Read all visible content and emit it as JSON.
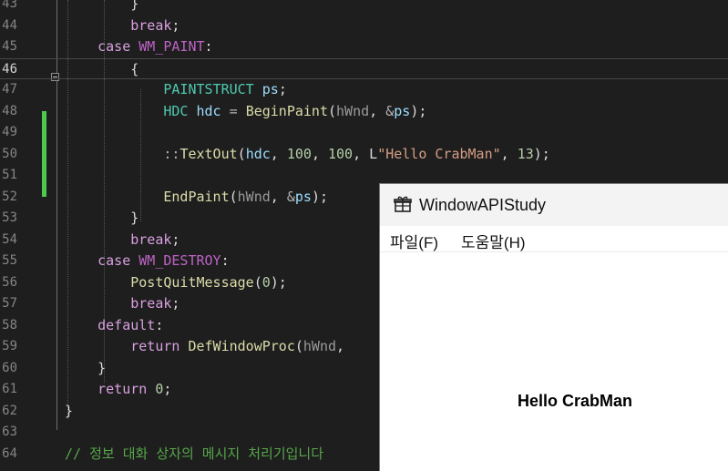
{
  "editor": {
    "lines": [
      {
        "num": "43",
        "tokens": [
          {
            "t": "        }",
            "c": ""
          }
        ]
      },
      {
        "num": "44",
        "tokens": [
          {
            "t": "        ",
            "c": ""
          },
          {
            "t": "break",
            "c": "t-ctl"
          },
          {
            "t": ";",
            "c": ""
          }
        ]
      },
      {
        "num": "45",
        "tokens": [
          {
            "t": "    ",
            "c": ""
          },
          {
            "t": "case",
            "c": "t-ctl"
          },
          {
            "t": " ",
            "c": ""
          },
          {
            "t": "WM_PAINT",
            "c": "t-mac"
          },
          {
            "t": ":",
            "c": ""
          }
        ]
      },
      {
        "num": "46",
        "tokens": [
          {
            "t": "        {",
            "c": ""
          }
        ]
      },
      {
        "num": "47",
        "tokens": [
          {
            "t": "            ",
            "c": ""
          },
          {
            "t": "PAINTSTRUCT",
            "c": "t-type"
          },
          {
            "t": " ",
            "c": ""
          },
          {
            "t": "ps",
            "c": "t-var"
          },
          {
            "t": ";",
            "c": ""
          }
        ]
      },
      {
        "num": "48",
        "tokens": [
          {
            "t": "            ",
            "c": ""
          },
          {
            "t": "HDC",
            "c": "t-type"
          },
          {
            "t": " ",
            "c": ""
          },
          {
            "t": "hdc",
            "c": "t-var"
          },
          {
            "t": " ",
            "c": ""
          },
          {
            "t": "=",
            "c": "t-op"
          },
          {
            "t": " ",
            "c": ""
          },
          {
            "t": "BeginPaint",
            "c": "t-fn"
          },
          {
            "t": "(",
            "c": ""
          },
          {
            "t": "hWnd",
            "c": "t-par"
          },
          {
            "t": ", ",
            "c": ""
          },
          {
            "t": "&",
            "c": "t-op"
          },
          {
            "t": "ps",
            "c": "t-var"
          },
          {
            "t": ");",
            "c": ""
          }
        ]
      },
      {
        "num": "49",
        "tokens": []
      },
      {
        "num": "50",
        "tokens": [
          {
            "t": "            ",
            "c": ""
          },
          {
            "t": "::",
            "c": "t-op"
          },
          {
            "t": "TextOut",
            "c": "t-fn"
          },
          {
            "t": "(",
            "c": ""
          },
          {
            "t": "hdc",
            "c": "t-var"
          },
          {
            "t": ", ",
            "c": ""
          },
          {
            "t": "100",
            "c": "t-num"
          },
          {
            "t": ", ",
            "c": ""
          },
          {
            "t": "100",
            "c": "t-num"
          },
          {
            "t": ", ",
            "c": ""
          },
          {
            "t": "L",
            "c": ""
          },
          {
            "t": "\"Hello CrabMan\"",
            "c": "t-str"
          },
          {
            "t": ", ",
            "c": ""
          },
          {
            "t": "13",
            "c": "t-num"
          },
          {
            "t": ");",
            "c": ""
          }
        ]
      },
      {
        "num": "51",
        "tokens": []
      },
      {
        "num": "52",
        "tokens": [
          {
            "t": "            ",
            "c": ""
          },
          {
            "t": "EndPaint",
            "c": "t-fn"
          },
          {
            "t": "(",
            "c": ""
          },
          {
            "t": "hWnd",
            "c": "t-par"
          },
          {
            "t": ", ",
            "c": ""
          },
          {
            "t": "&",
            "c": "t-op"
          },
          {
            "t": "ps",
            "c": "t-var"
          },
          {
            "t": ");",
            "c": ""
          }
        ]
      },
      {
        "num": "53",
        "tokens": [
          {
            "t": "        }",
            "c": ""
          }
        ]
      },
      {
        "num": "54",
        "tokens": [
          {
            "t": "        ",
            "c": ""
          },
          {
            "t": "break",
            "c": "t-ctl"
          },
          {
            "t": ";",
            "c": ""
          }
        ]
      },
      {
        "num": "55",
        "tokens": [
          {
            "t": "    ",
            "c": ""
          },
          {
            "t": "case",
            "c": "t-ctl"
          },
          {
            "t": " ",
            "c": ""
          },
          {
            "t": "WM_DESTROY",
            "c": "t-mac"
          },
          {
            "t": ":",
            "c": ""
          }
        ]
      },
      {
        "num": "56",
        "tokens": [
          {
            "t": "        ",
            "c": ""
          },
          {
            "t": "PostQuitMessage",
            "c": "t-fn"
          },
          {
            "t": "(",
            "c": ""
          },
          {
            "t": "0",
            "c": "t-num"
          },
          {
            "t": ");",
            "c": ""
          }
        ]
      },
      {
        "num": "57",
        "tokens": [
          {
            "t": "        ",
            "c": ""
          },
          {
            "t": "break",
            "c": "t-ctl"
          },
          {
            "t": ";",
            "c": ""
          }
        ]
      },
      {
        "num": "58",
        "tokens": [
          {
            "t": "    ",
            "c": ""
          },
          {
            "t": "default",
            "c": "t-ctl"
          },
          {
            "t": ":",
            "c": ""
          }
        ]
      },
      {
        "num": "59",
        "tokens": [
          {
            "t": "        ",
            "c": ""
          },
          {
            "t": "return",
            "c": "t-ctl"
          },
          {
            "t": " ",
            "c": ""
          },
          {
            "t": "DefWindowProc",
            "c": "t-fn"
          },
          {
            "t": "(",
            "c": ""
          },
          {
            "t": "hWnd",
            "c": "t-par"
          },
          {
            "t": ", ",
            "c": ""
          }
        ]
      },
      {
        "num": "60",
        "tokens": [
          {
            "t": "    }",
            "c": ""
          }
        ]
      },
      {
        "num": "61",
        "tokens": [
          {
            "t": "    ",
            "c": ""
          },
          {
            "t": "return",
            "c": "t-ctl"
          },
          {
            "t": " ",
            "c": ""
          },
          {
            "t": "0",
            "c": "t-num"
          },
          {
            "t": ";",
            "c": ""
          }
        ]
      },
      {
        "num": "62",
        "tokens": [
          {
            "t": "}",
            "c": ""
          }
        ]
      },
      {
        "num": "63",
        "tokens": []
      },
      {
        "num": "64",
        "tokens": [
          {
            "t": "// 정보 대화 상자의 메시지 처리기입니다",
            "c": "t-cmt"
          }
        ]
      }
    ],
    "current_line": "46"
  },
  "app_window": {
    "title": "WindowAPIStudy",
    "icon": "gift-icon",
    "menu": [
      "파일(F)",
      "도움말(H)"
    ],
    "client_text": "Hello CrabMan"
  }
}
